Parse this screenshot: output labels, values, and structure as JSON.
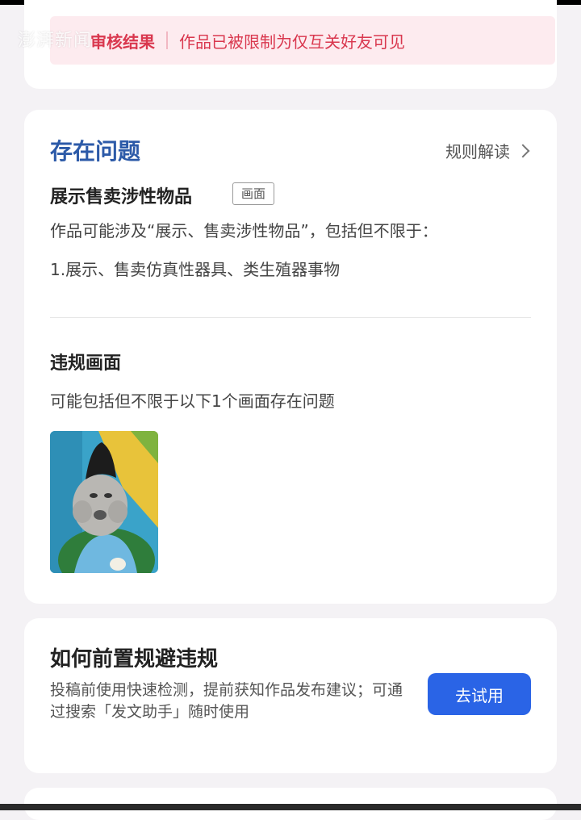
{
  "watermark": "澎湃新闻",
  "audit": {
    "label": "审核结果",
    "result_text": "作品已被限制为仅互关好友可见"
  },
  "problem": {
    "section_title": "存在问题",
    "rules_link": "规则解读",
    "issue_title": "展示售卖涉性物品",
    "issue_tag": "画面",
    "issue_desc": "作品可能涉及“展示、售卖涉性物品”，包括但不限于：",
    "issue_item": "1.展示、售卖仿真性器具、类生殖器事物",
    "violation_title": "违规画面",
    "violation_desc": "可能包括但不限于以下1个画面存在问题"
  },
  "prevention": {
    "title": "如何前置规避违规",
    "desc": "投稿前使用快速检测，提前获知作品发布建议；可通过搜索「发文助手」随时使用",
    "button_label": "去试用",
    "button_color": "#2a64e6"
  },
  "colors": {
    "accent_blue": "#2c5aa8",
    "alert_red": "#d9374e"
  }
}
